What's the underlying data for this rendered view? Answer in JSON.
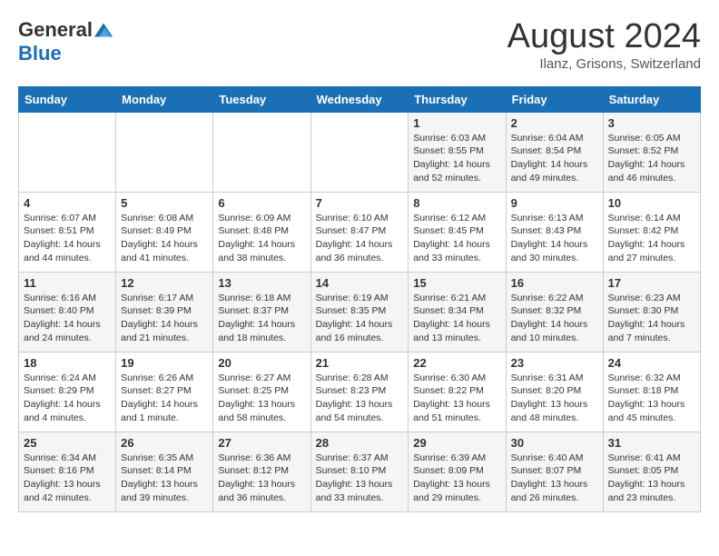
{
  "header": {
    "logo_general": "General",
    "logo_blue": "Blue",
    "month_year": "August 2024",
    "location": "Ilanz, Grisons, Switzerland"
  },
  "days_of_week": [
    "Sunday",
    "Monday",
    "Tuesday",
    "Wednesday",
    "Thursday",
    "Friday",
    "Saturday"
  ],
  "weeks": [
    [
      {
        "day": "",
        "info": ""
      },
      {
        "day": "",
        "info": ""
      },
      {
        "day": "",
        "info": ""
      },
      {
        "day": "",
        "info": ""
      },
      {
        "day": "1",
        "info": "Sunrise: 6:03 AM\nSunset: 8:55 PM\nDaylight: 14 hours and 52 minutes."
      },
      {
        "day": "2",
        "info": "Sunrise: 6:04 AM\nSunset: 8:54 PM\nDaylight: 14 hours and 49 minutes."
      },
      {
        "day": "3",
        "info": "Sunrise: 6:05 AM\nSunset: 8:52 PM\nDaylight: 14 hours and 46 minutes."
      }
    ],
    [
      {
        "day": "4",
        "info": "Sunrise: 6:07 AM\nSunset: 8:51 PM\nDaylight: 14 hours and 44 minutes."
      },
      {
        "day": "5",
        "info": "Sunrise: 6:08 AM\nSunset: 8:49 PM\nDaylight: 14 hours and 41 minutes."
      },
      {
        "day": "6",
        "info": "Sunrise: 6:09 AM\nSunset: 8:48 PM\nDaylight: 14 hours and 38 minutes."
      },
      {
        "day": "7",
        "info": "Sunrise: 6:10 AM\nSunset: 8:47 PM\nDaylight: 14 hours and 36 minutes."
      },
      {
        "day": "8",
        "info": "Sunrise: 6:12 AM\nSunset: 8:45 PM\nDaylight: 14 hours and 33 minutes."
      },
      {
        "day": "9",
        "info": "Sunrise: 6:13 AM\nSunset: 8:43 PM\nDaylight: 14 hours and 30 minutes."
      },
      {
        "day": "10",
        "info": "Sunrise: 6:14 AM\nSunset: 8:42 PM\nDaylight: 14 hours and 27 minutes."
      }
    ],
    [
      {
        "day": "11",
        "info": "Sunrise: 6:16 AM\nSunset: 8:40 PM\nDaylight: 14 hours and 24 minutes."
      },
      {
        "day": "12",
        "info": "Sunrise: 6:17 AM\nSunset: 8:39 PM\nDaylight: 14 hours and 21 minutes."
      },
      {
        "day": "13",
        "info": "Sunrise: 6:18 AM\nSunset: 8:37 PM\nDaylight: 14 hours and 18 minutes."
      },
      {
        "day": "14",
        "info": "Sunrise: 6:19 AM\nSunset: 8:35 PM\nDaylight: 14 hours and 16 minutes."
      },
      {
        "day": "15",
        "info": "Sunrise: 6:21 AM\nSunset: 8:34 PM\nDaylight: 14 hours and 13 minutes."
      },
      {
        "day": "16",
        "info": "Sunrise: 6:22 AM\nSunset: 8:32 PM\nDaylight: 14 hours and 10 minutes."
      },
      {
        "day": "17",
        "info": "Sunrise: 6:23 AM\nSunset: 8:30 PM\nDaylight: 14 hours and 7 minutes."
      }
    ],
    [
      {
        "day": "18",
        "info": "Sunrise: 6:24 AM\nSunset: 8:29 PM\nDaylight: 14 hours and 4 minutes."
      },
      {
        "day": "19",
        "info": "Sunrise: 6:26 AM\nSunset: 8:27 PM\nDaylight: 14 hours and 1 minute."
      },
      {
        "day": "20",
        "info": "Sunrise: 6:27 AM\nSunset: 8:25 PM\nDaylight: 13 hours and 58 minutes."
      },
      {
        "day": "21",
        "info": "Sunrise: 6:28 AM\nSunset: 8:23 PM\nDaylight: 13 hours and 54 minutes."
      },
      {
        "day": "22",
        "info": "Sunrise: 6:30 AM\nSunset: 8:22 PM\nDaylight: 13 hours and 51 minutes."
      },
      {
        "day": "23",
        "info": "Sunrise: 6:31 AM\nSunset: 8:20 PM\nDaylight: 13 hours and 48 minutes."
      },
      {
        "day": "24",
        "info": "Sunrise: 6:32 AM\nSunset: 8:18 PM\nDaylight: 13 hours and 45 minutes."
      }
    ],
    [
      {
        "day": "25",
        "info": "Sunrise: 6:34 AM\nSunset: 8:16 PM\nDaylight: 13 hours and 42 minutes."
      },
      {
        "day": "26",
        "info": "Sunrise: 6:35 AM\nSunset: 8:14 PM\nDaylight: 13 hours and 39 minutes."
      },
      {
        "day": "27",
        "info": "Sunrise: 6:36 AM\nSunset: 8:12 PM\nDaylight: 13 hours and 36 minutes."
      },
      {
        "day": "28",
        "info": "Sunrise: 6:37 AM\nSunset: 8:10 PM\nDaylight: 13 hours and 33 minutes."
      },
      {
        "day": "29",
        "info": "Sunrise: 6:39 AM\nSunset: 8:09 PM\nDaylight: 13 hours and 29 minutes."
      },
      {
        "day": "30",
        "info": "Sunrise: 6:40 AM\nSunset: 8:07 PM\nDaylight: 13 hours and 26 minutes."
      },
      {
        "day": "31",
        "info": "Sunrise: 6:41 AM\nSunset: 8:05 PM\nDaylight: 13 hours and 23 minutes."
      }
    ]
  ]
}
